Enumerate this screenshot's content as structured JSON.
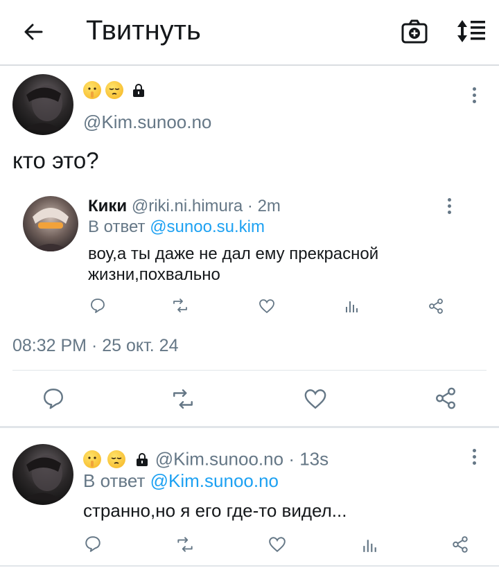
{
  "header": {
    "title": "Твитнуть"
  },
  "main_tweet": {
    "handle": "@Kim.sunoo.no",
    "text": "кто это?",
    "timestamp": "08:32 PM · 25 окт. 24"
  },
  "quoted": {
    "name": "Кики",
    "handle": "@riki.ni.himura",
    "time": "· 2m",
    "reply_prefix": "В ответ",
    "reply_to": "@sunoo.su.kim",
    "text_line1": "воу,а ты даже не дал ему прекрасной",
    "text_line2": "жизни,похвально"
  },
  "reply": {
    "handle": "@Kim.sunoo.no",
    "time": "· 13s",
    "reply_prefix": "В ответ",
    "reply_to": "@Kim.sunoo.no",
    "text": "странно,но я его где-то видел..."
  },
  "icons": [
    "back-arrow-icon",
    "camera-plus-icon",
    "sort-icon",
    "more-icon",
    "reply-icon",
    "retweet-icon",
    "like-icon",
    "stats-icon",
    "share-icon",
    "lock-icon"
  ],
  "colors": {
    "link": "#1da1f2",
    "muted": "#657786",
    "text": "#14171a",
    "divider": "#e1e5e9"
  }
}
